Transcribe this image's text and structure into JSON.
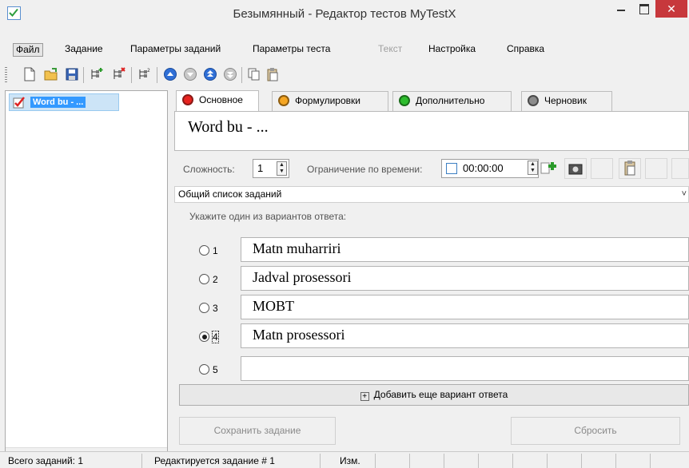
{
  "window": {
    "title": "Безымянный - Редактор тестов MyTestX",
    "close_glyph": "✕"
  },
  "menu": [
    {
      "label": "Файл",
      "active": true
    },
    {
      "label": "Задание"
    },
    {
      "label": "Параметры заданий"
    },
    {
      "label": "Параметры теста"
    },
    {
      "label": "Текст",
      "disabled": true
    },
    {
      "label": "Настройка"
    },
    {
      "label": "Справка"
    }
  ],
  "toolbar": {
    "icons": [
      "new-file-icon",
      "open-folder-icon",
      "save-icon",
      "add-task-icon",
      "delete-task-icon",
      "task-number-icon",
      "move-up-icon",
      "move-down-icon",
      "move-top-icon",
      "move-bottom-icon",
      "copy-icon",
      "paste-icon"
    ]
  },
  "tree": {
    "items": [
      {
        "label": "Word bu - ..."
      }
    ],
    "scroll_left": "‹",
    "scroll_right": "›"
  },
  "tabs": [
    {
      "label": "Основное",
      "color": "#e8231f",
      "active": true
    },
    {
      "label": "Формулировки",
      "color": "#f5a623"
    },
    {
      "label": "Дополнительно",
      "color": "#2ebd2e"
    },
    {
      "label": "Черновик",
      "color": "#8c8c8c"
    }
  ],
  "question": {
    "text": "Word bu - ..."
  },
  "params": {
    "difficulty_label": "Сложность:",
    "difficulty_value": "1",
    "time_limit_label": "Ограничение по времени:",
    "time_value": "00:00:00",
    "time_enabled": false
  },
  "list_header": {
    "label": "Общий список заданий",
    "chevron": "˅"
  },
  "hint": "Укажите один из вариантов ответа:",
  "answers": [
    {
      "num": "1",
      "text": "Matn muharriri",
      "checked": false
    },
    {
      "num": "2",
      "text": "Jadval prosessori",
      "checked": false
    },
    {
      "num": "3",
      "text": "MOBT",
      "checked": false
    },
    {
      "num": "4",
      "text": "Matn prosessori",
      "checked": true
    },
    {
      "num": "5",
      "text": "",
      "checked": false
    }
  ],
  "buttons": {
    "add_answer": "Добавить еще вариант ответа",
    "add_plus": "+",
    "save": "Сохранить задание",
    "reset": "Сбросить"
  },
  "status": {
    "total": "Всего заданий: 1",
    "editing": "Редактируется задание # 1",
    "modified": "Изм."
  },
  "colors": {
    "accent": "#3399ff",
    "close_button": "#c7383c",
    "selection_bg": "#cce4f7"
  }
}
